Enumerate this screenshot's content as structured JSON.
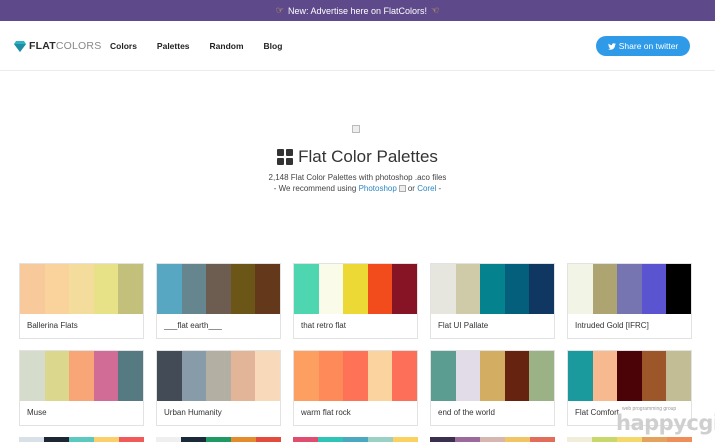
{
  "announcement": {
    "text": "New: Advertise here on FlatColors!"
  },
  "logo": {
    "flat": "FLAT",
    "colors": "COLORS"
  },
  "nav": {
    "links": [
      "Colors",
      "Palettes",
      "Random",
      "Blog"
    ]
  },
  "tweet": {
    "label": "Share on twitter"
  },
  "header": {
    "title": "Flat Color Palettes",
    "subtitle": "2,148 Flat Color Palettes with photoshop .aco files",
    "recommend_prefix": "- We recommend using",
    "photoshop": "Photoshop",
    "or": "or",
    "corel": "Corel",
    "recommend_suffix": "-"
  },
  "palettes": [
    {
      "name": "Ballerina Flats",
      "colors": [
        "#f8c99a",
        "#f9d39b",
        "#f4dc9c",
        "#e7e188",
        "#c2c07b"
      ]
    },
    {
      "name": "___flat earth___",
      "colors": [
        "#58a7c2",
        "#65858f",
        "#6d5c50",
        "#6b5617",
        "#64381a"
      ]
    },
    {
      "name": "that retro flat",
      "colors": [
        "#4ed6b1",
        "#fbfbea",
        "#ecd935",
        "#f24c1c",
        "#861424"
      ]
    },
    {
      "name": "Flat UI Pallate",
      "colors": [
        "#e6e6df",
        "#cfcba9",
        "#04838f",
        "#045f7d",
        "#103662"
      ]
    },
    {
      "name": "Intruded Gold [IFRC]",
      "colors": [
        "#f2f5e6",
        "#aea472",
        "#7775b1",
        "#5b54d0",
        "#000000"
      ]
    },
    {
      "name": "Muse",
      "colors": [
        "#d6dccb",
        "#dbd88e",
        "#f8a578",
        "#d06c95",
        "#557a81"
      ]
    },
    {
      "name": "Urban Humanity",
      "colors": [
        "#434b57",
        "#879ba8",
        "#b3b0a3",
        "#e3b598",
        "#f8d9ba"
      ]
    },
    {
      "name": "warm flat rock",
      "colors": [
        "#fe9f62",
        "#fe8a59",
        "#fe7358",
        "#fbd39f",
        "#fe6f5a"
      ]
    },
    {
      "name": "end of the world",
      "colors": [
        "#5c9d91",
        "#e1dce8",
        "#d3ae62",
        "#652310",
        "#9bb287"
      ]
    },
    {
      "name": "Flat Comfort",
      "colors": [
        "#1b9a9e",
        "#f7b98f",
        "#4b0308",
        "#9d562a",
        "#c2bd95"
      ]
    }
  ],
  "next_row_colors": [
    [
      "#d9e1e8",
      "#1c2733",
      "#5cc9c0",
      "#fbd06b",
      "#f25a5a"
    ],
    [
      "#efefef",
      "#1b2a3a",
      "#1f9a65",
      "#e48b2b",
      "#e34c3d"
    ],
    [
      "#e04d6f",
      "#2ec4b6",
      "#4aa9c0",
      "#9ad1c4",
      "#fbd15f"
    ],
    [
      "#3b2f4f",
      "#9b6a9d",
      "#d6b6b0",
      "#f2c564",
      "#e26d5a"
    ],
    [
      "#f2edd8",
      "#c9d76b",
      "#f5d86a",
      "#e5a25c",
      "#f08e5a"
    ]
  ],
  "watermark": {
    "small": "web programming group",
    "big": "happycgi"
  }
}
